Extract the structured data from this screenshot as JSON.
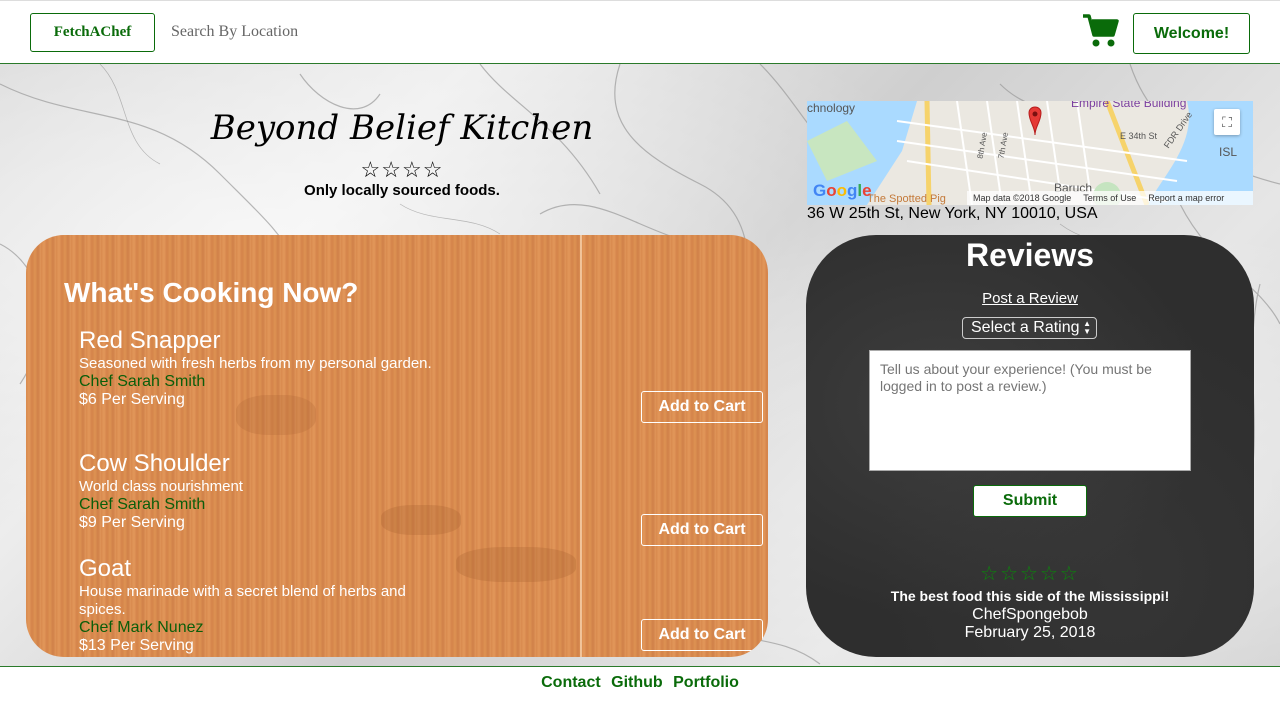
{
  "navbar": {
    "brand": "FetchAChef",
    "search_placeholder": "Search By Location",
    "welcome": "Welcome!"
  },
  "kitchen": {
    "name": "Beyond Belief Kitchen",
    "stars": "☆☆☆☆",
    "tagline": "Only locally sourced foods."
  },
  "map": {
    "labels": {
      "area": "chnology",
      "empire": "Empire State Building",
      "e34": "E 34th St",
      "fdr": "FDR Drive",
      "ave8": "8th Ave",
      "ave7": "7th Ave",
      "isl": "ISL",
      "baruch": "Baruch",
      "spotted": "The Spotted Pig"
    },
    "google": "Google",
    "footer_data": "Map data ©2018 Google",
    "footer_terms": "Terms of Use",
    "footer_report": "Report a map error",
    "address": "36 W 25th St, New York, NY 10010, USA"
  },
  "cooking": {
    "title": "What's Cooking Now?",
    "add_to_cart": "Add to Cart",
    "dishes": [
      {
        "name": "Red Snapper",
        "desc": "Seasoned with fresh herbs from my personal garden.",
        "chef": "Chef Sarah Smith",
        "price": "$6 Per Serving"
      },
      {
        "name": "Cow Shoulder",
        "desc": "World class nourishment",
        "chef": "Chef Sarah Smith",
        "price": "$9 Per Serving"
      },
      {
        "name": "Goat",
        "desc": "House marinade with a secret blend of herbs and spices.",
        "chef": "Chef Mark Nunez",
        "price": "$13 Per Serving"
      }
    ]
  },
  "reviews": {
    "title": "Reviews",
    "post_link": "Post a Review",
    "rating_select": "Select a Rating",
    "textarea_placeholder": "Tell us about your experience! (You must be logged in to post a review.)",
    "submit": "Submit",
    "latest": {
      "stars": "☆☆☆☆☆",
      "text": "The best food this side of the Mississippi!",
      "author": "ChefSpongebob",
      "date": "February 25, 2018"
    }
  },
  "footer": {
    "links": [
      "Contact",
      "Github",
      "Portfolio"
    ]
  },
  "colors": {
    "brand_green": "#0a6b0a",
    "chalkboard": "#2e2e2e",
    "wood": "#d88a4e"
  }
}
